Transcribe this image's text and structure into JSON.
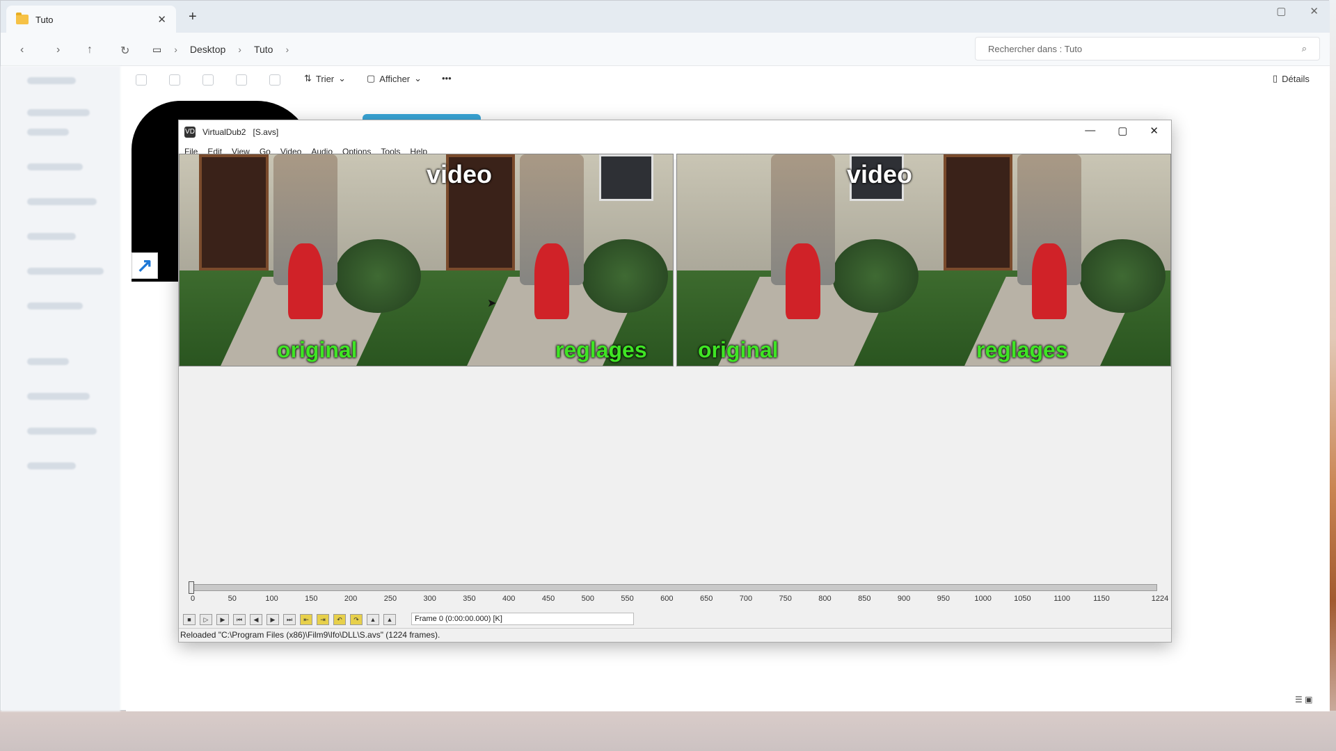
{
  "explorer": {
    "tab_title": "Tuto",
    "tab_close": "✕",
    "new_tab": "+",
    "window_controls": [
      "▢",
      "✕"
    ],
    "nav": {
      "back": "‹",
      "forward": "›",
      "up": "↑",
      "refresh": "↻"
    },
    "breadcrumb": [
      "Desktop",
      "Tuto"
    ],
    "search_placeholder": "Rechercher dans : Tuto",
    "toolbar": {
      "sort_label": "Trier",
      "view_label": "Afficher",
      "more": "•••",
      "details_label": "Détails"
    },
    "shortcut_arrow": "↗"
  },
  "virtualdub": {
    "title": "VirtualDub2",
    "file": "[S.avs]",
    "logo": "VD",
    "controls": [
      "—",
      "▢",
      "✕"
    ],
    "menu": [
      "File",
      "Edit",
      "View",
      "Go",
      "Video",
      "Audio",
      "Options",
      "Tools",
      "Help"
    ],
    "panes": [
      {
        "video": "video",
        "left_label": "original",
        "right_label": "reglages"
      },
      {
        "video": "video",
        "left_label": "original",
        "right_label": "reglages"
      }
    ],
    "timeline_ticks": [
      "0",
      "50",
      "100",
      "150",
      "200",
      "250",
      "300",
      "350",
      "400",
      "450",
      "500",
      "550",
      "600",
      "650",
      "700",
      "750",
      "800",
      "850",
      "900",
      "950",
      "1000",
      "1050",
      "1100",
      "1150",
      "1224"
    ],
    "total_frames": 1224,
    "current_frame": 0,
    "frame_info": "Frame 0 (0:00:00.000) [K]",
    "status": "Reloaded \"C:\\Program Files (x86)\\Film9\\Ifo\\DLL\\S.avs\" (1224 frames)."
  },
  "colors": {
    "label_green": "#3fe524",
    "accent_blue": "#1e78d7"
  }
}
